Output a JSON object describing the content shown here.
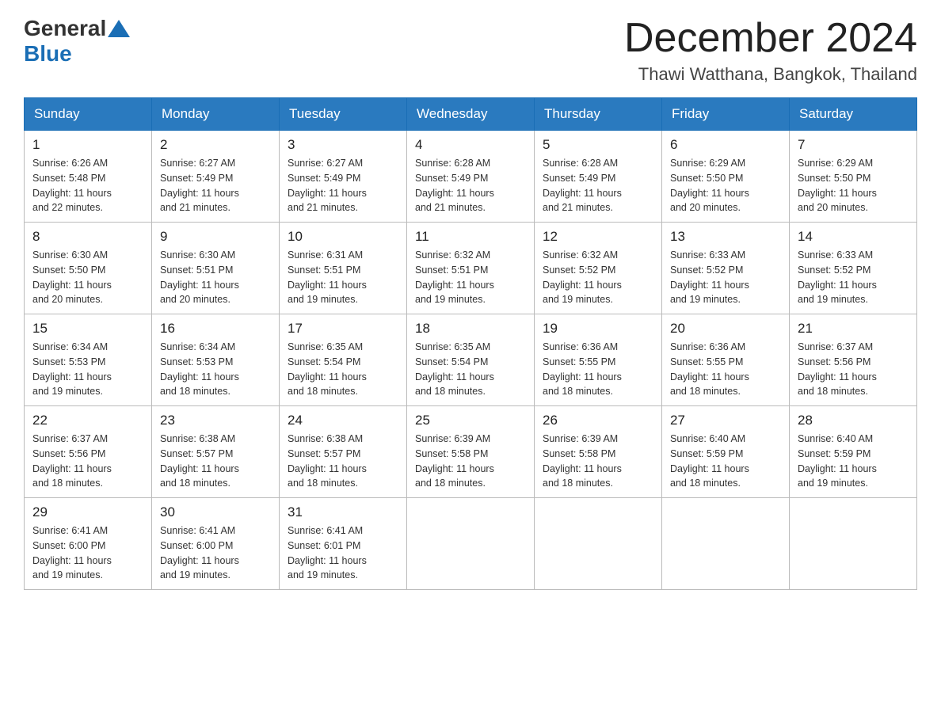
{
  "header": {
    "logo_text_general": "General",
    "logo_text_blue": "Blue",
    "month_title": "December 2024",
    "location": "Thawi Watthana, Bangkok, Thailand"
  },
  "days_of_week": [
    "Sunday",
    "Monday",
    "Tuesday",
    "Wednesday",
    "Thursday",
    "Friday",
    "Saturday"
  ],
  "weeks": [
    [
      {
        "day": "1",
        "sunrise": "6:26 AM",
        "sunset": "5:48 PM",
        "daylight": "11 hours and 22 minutes."
      },
      {
        "day": "2",
        "sunrise": "6:27 AM",
        "sunset": "5:49 PM",
        "daylight": "11 hours and 21 minutes."
      },
      {
        "day": "3",
        "sunrise": "6:27 AM",
        "sunset": "5:49 PM",
        "daylight": "11 hours and 21 minutes."
      },
      {
        "day": "4",
        "sunrise": "6:28 AM",
        "sunset": "5:49 PM",
        "daylight": "11 hours and 21 minutes."
      },
      {
        "day": "5",
        "sunrise": "6:28 AM",
        "sunset": "5:49 PM",
        "daylight": "11 hours and 21 minutes."
      },
      {
        "day": "6",
        "sunrise": "6:29 AM",
        "sunset": "5:50 PM",
        "daylight": "11 hours and 20 minutes."
      },
      {
        "day": "7",
        "sunrise": "6:29 AM",
        "sunset": "5:50 PM",
        "daylight": "11 hours and 20 minutes."
      }
    ],
    [
      {
        "day": "8",
        "sunrise": "6:30 AM",
        "sunset": "5:50 PM",
        "daylight": "11 hours and 20 minutes."
      },
      {
        "day": "9",
        "sunrise": "6:30 AM",
        "sunset": "5:51 PM",
        "daylight": "11 hours and 20 minutes."
      },
      {
        "day": "10",
        "sunrise": "6:31 AM",
        "sunset": "5:51 PM",
        "daylight": "11 hours and 19 minutes."
      },
      {
        "day": "11",
        "sunrise": "6:32 AM",
        "sunset": "5:51 PM",
        "daylight": "11 hours and 19 minutes."
      },
      {
        "day": "12",
        "sunrise": "6:32 AM",
        "sunset": "5:52 PM",
        "daylight": "11 hours and 19 minutes."
      },
      {
        "day": "13",
        "sunrise": "6:33 AM",
        "sunset": "5:52 PM",
        "daylight": "11 hours and 19 minutes."
      },
      {
        "day": "14",
        "sunrise": "6:33 AM",
        "sunset": "5:52 PM",
        "daylight": "11 hours and 19 minutes."
      }
    ],
    [
      {
        "day": "15",
        "sunrise": "6:34 AM",
        "sunset": "5:53 PM",
        "daylight": "11 hours and 19 minutes."
      },
      {
        "day": "16",
        "sunrise": "6:34 AM",
        "sunset": "5:53 PM",
        "daylight": "11 hours and 18 minutes."
      },
      {
        "day": "17",
        "sunrise": "6:35 AM",
        "sunset": "5:54 PM",
        "daylight": "11 hours and 18 minutes."
      },
      {
        "day": "18",
        "sunrise": "6:35 AM",
        "sunset": "5:54 PM",
        "daylight": "11 hours and 18 minutes."
      },
      {
        "day": "19",
        "sunrise": "6:36 AM",
        "sunset": "5:55 PM",
        "daylight": "11 hours and 18 minutes."
      },
      {
        "day": "20",
        "sunrise": "6:36 AM",
        "sunset": "5:55 PM",
        "daylight": "11 hours and 18 minutes."
      },
      {
        "day": "21",
        "sunrise": "6:37 AM",
        "sunset": "5:56 PM",
        "daylight": "11 hours and 18 minutes."
      }
    ],
    [
      {
        "day": "22",
        "sunrise": "6:37 AM",
        "sunset": "5:56 PM",
        "daylight": "11 hours and 18 minutes."
      },
      {
        "day": "23",
        "sunrise": "6:38 AM",
        "sunset": "5:57 PM",
        "daylight": "11 hours and 18 minutes."
      },
      {
        "day": "24",
        "sunrise": "6:38 AM",
        "sunset": "5:57 PM",
        "daylight": "11 hours and 18 minutes."
      },
      {
        "day": "25",
        "sunrise": "6:39 AM",
        "sunset": "5:58 PM",
        "daylight": "11 hours and 18 minutes."
      },
      {
        "day": "26",
        "sunrise": "6:39 AM",
        "sunset": "5:58 PM",
        "daylight": "11 hours and 18 minutes."
      },
      {
        "day": "27",
        "sunrise": "6:40 AM",
        "sunset": "5:59 PM",
        "daylight": "11 hours and 18 minutes."
      },
      {
        "day": "28",
        "sunrise": "6:40 AM",
        "sunset": "5:59 PM",
        "daylight": "11 hours and 19 minutes."
      }
    ],
    [
      {
        "day": "29",
        "sunrise": "6:41 AM",
        "sunset": "6:00 PM",
        "daylight": "11 hours and 19 minutes."
      },
      {
        "day": "30",
        "sunrise": "6:41 AM",
        "sunset": "6:00 PM",
        "daylight": "11 hours and 19 minutes."
      },
      {
        "day": "31",
        "sunrise": "6:41 AM",
        "sunset": "6:01 PM",
        "daylight": "11 hours and 19 minutes."
      },
      null,
      null,
      null,
      null
    ]
  ],
  "labels": {
    "sunrise": "Sunrise:",
    "sunset": "Sunset:",
    "daylight": "Daylight:"
  }
}
